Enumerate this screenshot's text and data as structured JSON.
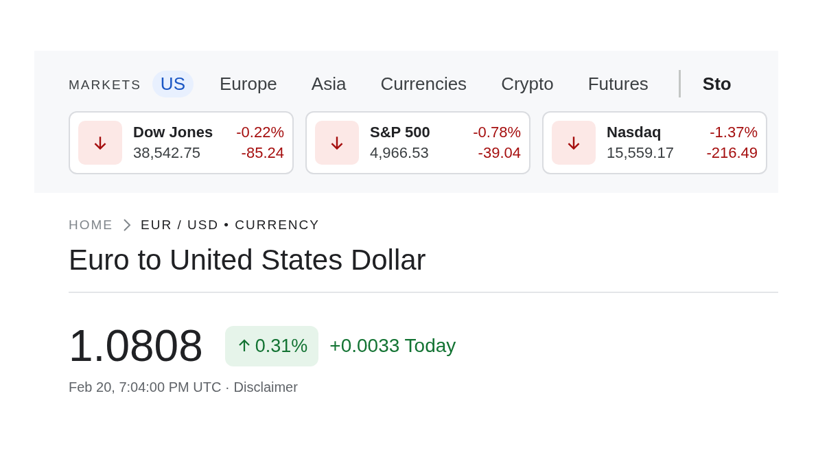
{
  "markets": {
    "label": "MARKETS",
    "tabs": [
      {
        "label": "US",
        "selected": true
      },
      {
        "label": "Europe",
        "selected": false
      },
      {
        "label": "Asia",
        "selected": false
      },
      {
        "label": "Currencies",
        "selected": false
      },
      {
        "label": "Crypto",
        "selected": false
      },
      {
        "label": "Futures",
        "selected": false
      }
    ],
    "more_tab": "Sto",
    "indices": [
      {
        "name": "Dow Jones",
        "value": "38,542.75",
        "percent": "-0.22%",
        "change": "-85.24",
        "kind": "down"
      },
      {
        "name": "S&P 500",
        "value": "4,966.53",
        "percent": "-0.78%",
        "change": "-39.04",
        "kind": "down"
      },
      {
        "name": "Nasdaq",
        "value": "15,559.17",
        "percent": "-1.37%",
        "change": "-216.49",
        "kind": "down"
      }
    ]
  },
  "breadcrumb": {
    "home": "HOME",
    "current": "EUR / USD • CURRENCY"
  },
  "title": "Euro to United States Dollar",
  "quote": {
    "price": "1.0808",
    "kind": "up",
    "percent": "0.31%",
    "change": "+0.0033 Today",
    "timestamp": "Feb 20, 7:04:00 PM UTC ·",
    "disclaimer": "Disclaimer"
  }
}
